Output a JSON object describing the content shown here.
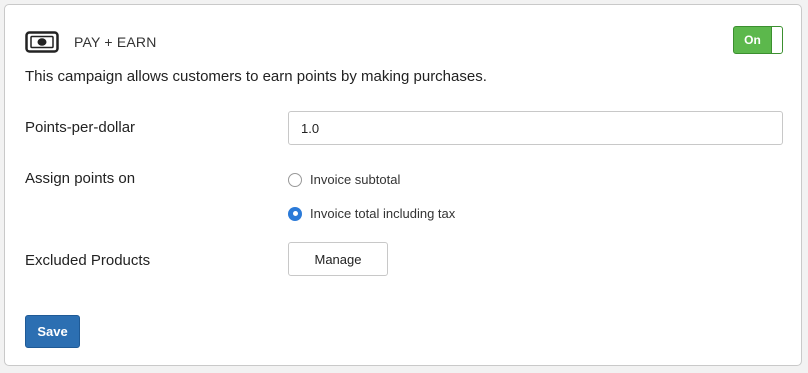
{
  "campaign": {
    "icon": "money-bill-icon",
    "title": "PAY + EARN",
    "toggle_label": "On",
    "toggle_on": true,
    "description": "This campaign allows customers to earn points by making purchases."
  },
  "form": {
    "points_per_dollar": {
      "label": "Points-per-dollar",
      "value": "1.0"
    },
    "assign_points": {
      "label": "Assign points on",
      "options": [
        {
          "label": "Invoice subtotal",
          "checked": false
        },
        {
          "label": "Invoice total including tax",
          "checked": true
        }
      ]
    },
    "excluded_products": {
      "label": "Excluded Products",
      "button_label": "Manage"
    }
  },
  "actions": {
    "save_label": "Save"
  },
  "colors": {
    "toggle_green": "#5cb84c",
    "save_blue": "#2c6fb2",
    "radio_blue": "#2b7ad8"
  }
}
